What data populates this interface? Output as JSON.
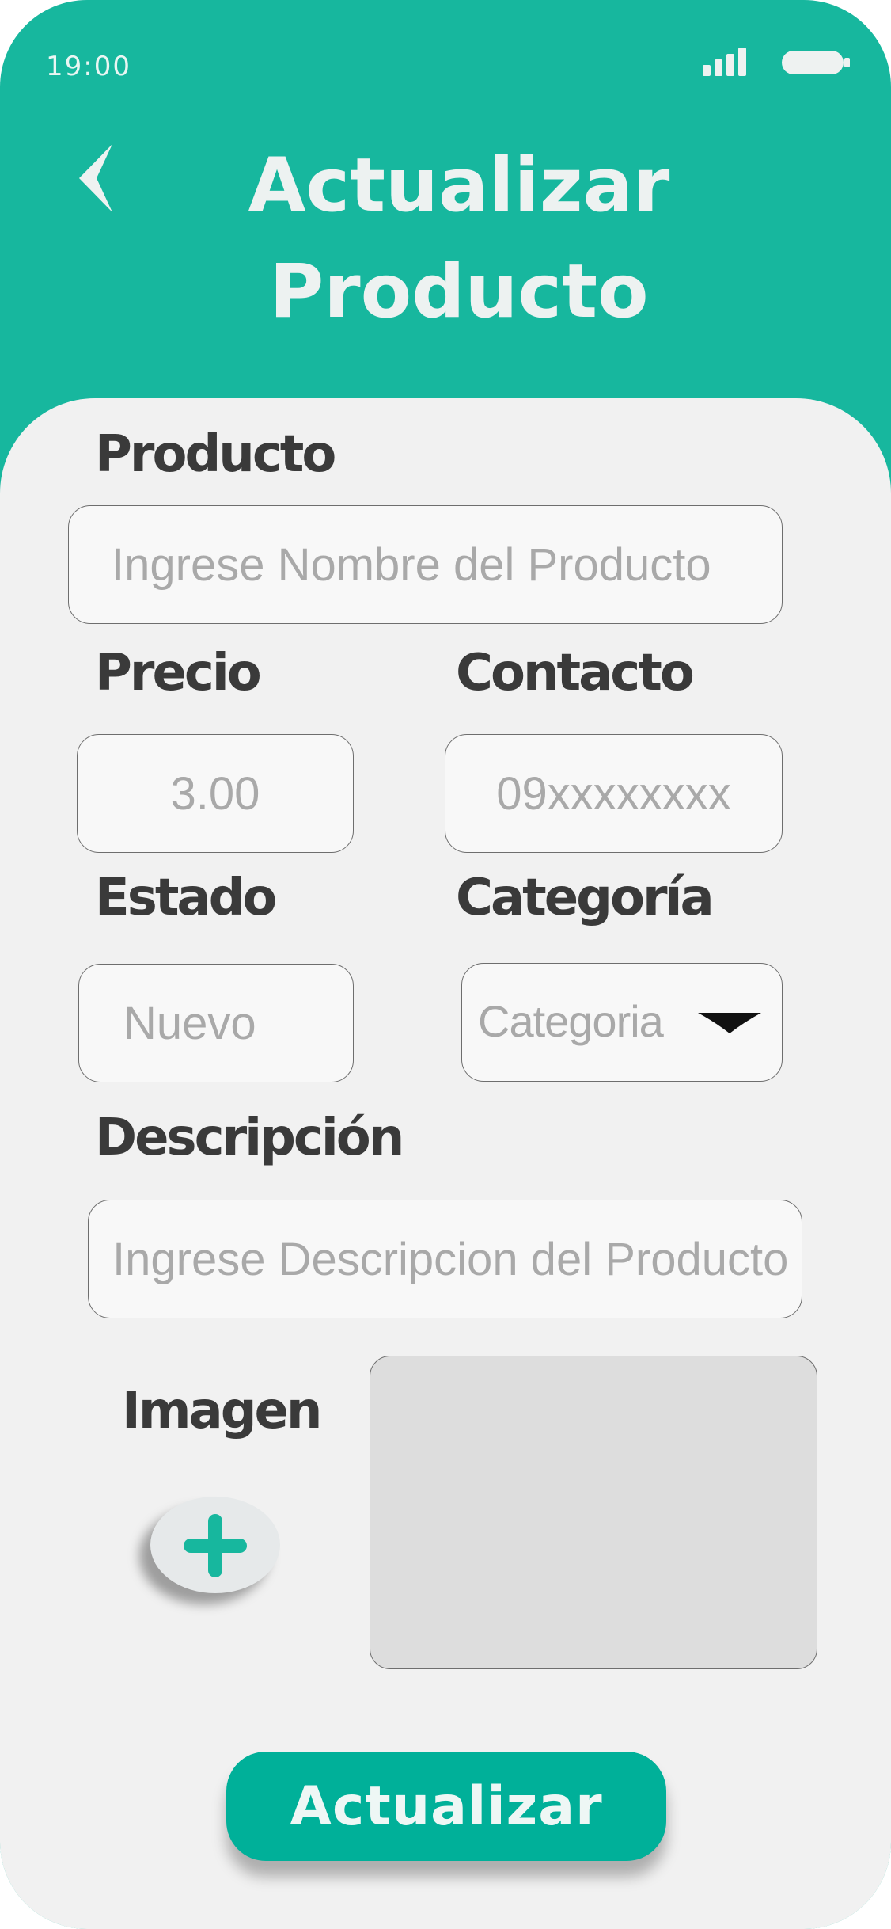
{
  "status_bar": {
    "time": "19:00"
  },
  "header": {
    "title_line1": "Actualizar",
    "title_line2": "Producto"
  },
  "form": {
    "product": {
      "label": "Producto",
      "placeholder": "Ingrese Nombre del Producto"
    },
    "price": {
      "label": "Precio",
      "placeholder": "3.00"
    },
    "contact": {
      "label": "Contacto",
      "placeholder": "09xxxxxxxx"
    },
    "state": {
      "label": "Estado",
      "placeholder": "Nuevo"
    },
    "category": {
      "label": "Categoría",
      "selected": "Categoria"
    },
    "description": {
      "label": "Descripción",
      "placeholder": "Ingrese Descripcion del Producto"
    },
    "image": {
      "label": "Imagen"
    },
    "submit_label": "Actualizar"
  },
  "colors": {
    "header_bg": "#17b79e",
    "button_bg": "#00b099",
    "card_bg": "#f1f1f1",
    "plus_icon": "#17b79e"
  },
  "icons": {
    "back": "chevron-left-icon",
    "signal": "signal-icon",
    "battery": "battery-icon",
    "dropdown": "caret-down-icon",
    "add": "plus-icon"
  }
}
